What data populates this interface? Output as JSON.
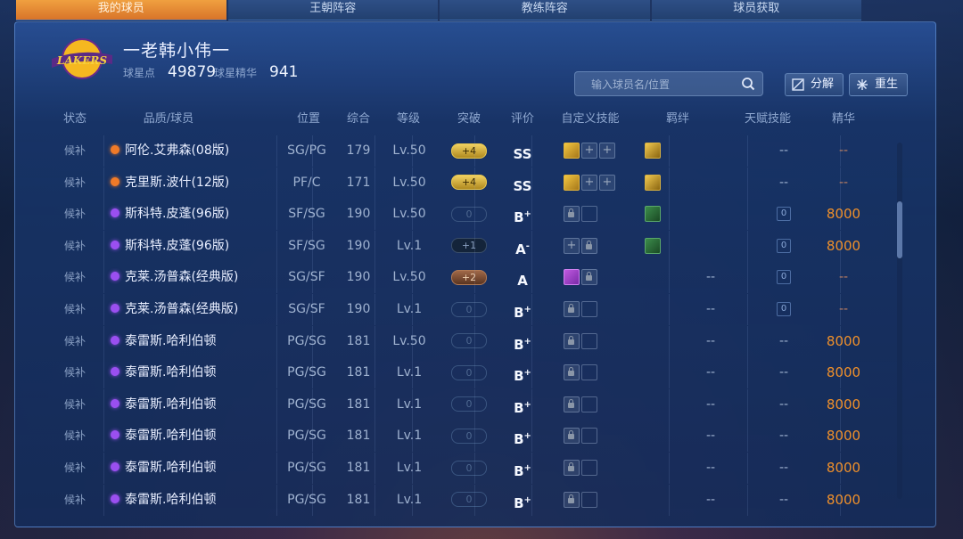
{
  "tabs": [
    "我的球员",
    "王朝阵容",
    "教练阵容",
    "球员获取"
  ],
  "profile": {
    "username": "一老韩小伟一",
    "star_points_label": "球星点",
    "star_points_value": "49879",
    "essence_label": "球星精华",
    "essence_value": "941",
    "logo_text": "LAKERS"
  },
  "search": {
    "placeholder": "输入球员名/位置"
  },
  "buttons": {
    "decompose": "分解",
    "rebirth": "重生"
  },
  "headers": [
    "状态",
    "品质/球员",
    "位置",
    "综合",
    "等级",
    "突破",
    "评价",
    "自定义技能",
    "羁绊",
    "天赋技能",
    "精华"
  ],
  "rows": [
    {
      "state": "候补",
      "quality": "orange",
      "name": "阿伦.艾弗森(08版)",
      "pos": "SG/PG",
      "overall": "179",
      "level": "Lv.50",
      "breakthrough": "+4",
      "bt_style": "gold",
      "grade": "SS",
      "grade_sup": "",
      "skills": [
        "skill",
        "plus",
        "plus"
      ],
      "bond": "gold",
      "talent": "--",
      "essence": "--"
    },
    {
      "state": "候补",
      "quality": "orange",
      "name": "克里斯.波什(12版)",
      "pos": "PF/C",
      "overall": "171",
      "level": "Lv.50",
      "breakthrough": "+4",
      "bt_style": "gold",
      "grade": "SS",
      "grade_sup": "",
      "skills": [
        "skill",
        "plus",
        "plus"
      ],
      "bond": "gold",
      "talent": "--",
      "essence": "--"
    },
    {
      "state": "候补",
      "quality": "purple",
      "name": "斯科特.皮蓬(96版)",
      "pos": "SF/SG",
      "overall": "190",
      "level": "Lv.50",
      "breakthrough": "0",
      "bt_style": "empty",
      "grade": "B",
      "grade_sup": "+",
      "skills": [
        "lock",
        "blank"
      ],
      "bond": "green",
      "talent": "0",
      "essence": "8000"
    },
    {
      "state": "候补",
      "quality": "purple",
      "name": "斯科特.皮蓬(96版)",
      "pos": "SF/SG",
      "overall": "190",
      "level": "Lv.1",
      "breakthrough": "+1",
      "bt_style": "dark",
      "grade": "A",
      "grade_sup": "-",
      "skills": [
        "plus",
        "lock"
      ],
      "bond": "green",
      "talent": "0",
      "essence": "8000"
    },
    {
      "state": "候补",
      "quality": "purple",
      "name": "克莱.汤普森(经典版)",
      "pos": "SG/SF",
      "overall": "190",
      "level": "Lv.50",
      "breakthrough": "+2",
      "bt_style": "bronze",
      "grade": "A",
      "grade_sup": "",
      "skills": [
        "purple",
        "lock"
      ],
      "bond": "",
      "talent": "0",
      "essence": "--"
    },
    {
      "state": "候补",
      "quality": "purple",
      "name": "克莱.汤普森(经典版)",
      "pos": "SG/SF",
      "overall": "190",
      "level": "Lv.1",
      "breakthrough": "0",
      "bt_style": "empty",
      "grade": "B",
      "grade_sup": "+",
      "skills": [
        "lock",
        "blank"
      ],
      "bond": "",
      "talent": "0",
      "essence": "--"
    },
    {
      "state": "候补",
      "quality": "purple",
      "name": "泰雷斯.哈利伯顿",
      "pos": "PG/SG",
      "overall": "181",
      "level": "Lv.50",
      "breakthrough": "0",
      "bt_style": "empty",
      "grade": "B",
      "grade_sup": "+",
      "skills": [
        "lock",
        "blank"
      ],
      "bond": "",
      "talent": "--",
      "essence": "8000"
    },
    {
      "state": "候补",
      "quality": "purple",
      "name": "泰雷斯.哈利伯顿",
      "pos": "PG/SG",
      "overall": "181",
      "level": "Lv.1",
      "breakthrough": "0",
      "bt_style": "empty",
      "grade": "B",
      "grade_sup": "+",
      "skills": [
        "lock",
        "blank"
      ],
      "bond": "",
      "talent": "--",
      "essence": "8000"
    },
    {
      "state": "候补",
      "quality": "purple",
      "name": "泰雷斯.哈利伯顿",
      "pos": "PG/SG",
      "overall": "181",
      "level": "Lv.1",
      "breakthrough": "0",
      "bt_style": "empty",
      "grade": "B",
      "grade_sup": "+",
      "skills": [
        "lock",
        "blank"
      ],
      "bond": "",
      "talent": "--",
      "essence": "8000"
    },
    {
      "state": "候补",
      "quality": "purple",
      "name": "泰雷斯.哈利伯顿",
      "pos": "PG/SG",
      "overall": "181",
      "level": "Lv.1",
      "breakthrough": "0",
      "bt_style": "empty",
      "grade": "B",
      "grade_sup": "+",
      "skills": [
        "lock",
        "blank"
      ],
      "bond": "",
      "talent": "--",
      "essence": "8000"
    },
    {
      "state": "候补",
      "quality": "purple",
      "name": "泰雷斯.哈利伯顿",
      "pos": "PG/SG",
      "overall": "181",
      "level": "Lv.1",
      "breakthrough": "0",
      "bt_style": "empty",
      "grade": "B",
      "grade_sup": "+",
      "skills": [
        "lock",
        "blank"
      ],
      "bond": "",
      "talent": "--",
      "essence": "8000"
    },
    {
      "state": "候补",
      "quality": "purple",
      "name": "泰雷斯.哈利伯顿",
      "pos": "PG/SG",
      "overall": "181",
      "level": "Lv.1",
      "breakthrough": "0",
      "bt_style": "empty",
      "grade": "B",
      "grade_sup": "+",
      "skills": [
        "lock",
        "blank"
      ],
      "bond": "",
      "talent": "--",
      "essence": "8000"
    }
  ],
  "colors": {
    "tab_active": "#e8862e",
    "quality_orange": "#f07a28",
    "quality_purple": "#9a4ff0",
    "essence": "#f0902a",
    "panel": "#1c3c78"
  },
  "icons": {
    "search": "search-icon",
    "decompose": "decompose-icon",
    "rebirth": "rebirth-icon",
    "lock": "lock-icon",
    "plus": "plus-icon"
  }
}
